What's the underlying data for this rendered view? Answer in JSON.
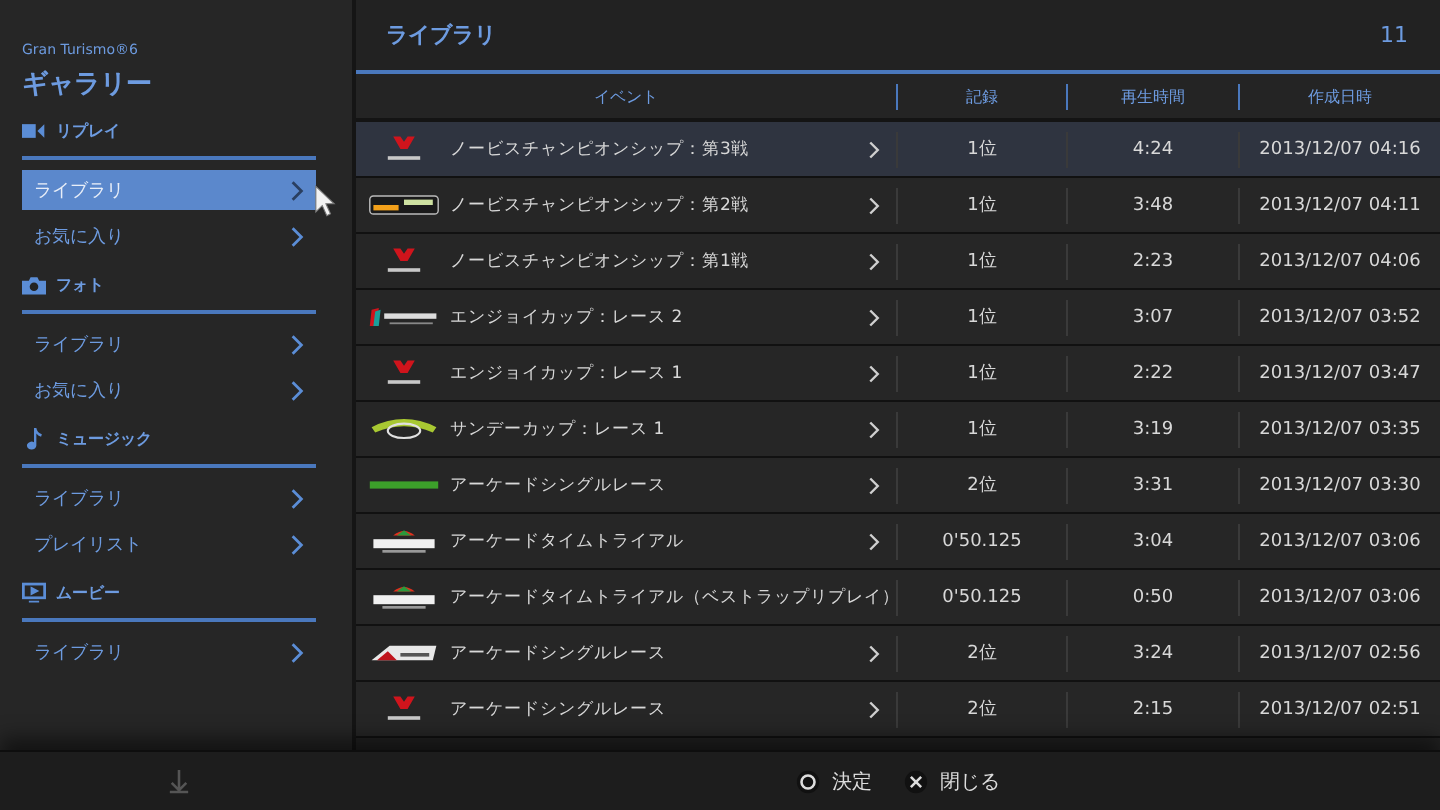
{
  "app": {
    "subtitle": "Gran Turismo®6",
    "title": "ギャラリー"
  },
  "sidebar": {
    "sections": [
      {
        "kind": "video",
        "label": "リプレイ",
        "items": [
          {
            "label": "ライブラリ",
            "selected": true
          },
          {
            "label": "お気に入り",
            "selected": false
          }
        ]
      },
      {
        "kind": "camera",
        "label": "フォト",
        "items": [
          {
            "label": "ライブラリ",
            "selected": false
          },
          {
            "label": "お気に入り",
            "selected": false
          }
        ]
      },
      {
        "kind": "music",
        "label": "ミュージック",
        "items": [
          {
            "label": "ライブラリ",
            "selected": false
          },
          {
            "label": "プレイリスト",
            "selected": false
          }
        ]
      },
      {
        "kind": "screen",
        "label": "ムービー",
        "items": [
          {
            "label": "ライブラリ",
            "selected": false
          }
        ]
      }
    ]
  },
  "panel": {
    "title": "ライブラリ",
    "count": "11"
  },
  "table": {
    "columns": [
      "イベント",
      "記録",
      "再生時間",
      "作成日時"
    ],
    "rows": [
      {
        "kind": "flag",
        "event": "ノービスチャンピオンシップ：第3戦",
        "record": "1位",
        "time": "4:24",
        "date": "2013/12/07 04:16",
        "selected": true
      },
      {
        "kind": "stripe",
        "event": "ノービスチャンピオンシップ：第2戦",
        "record": "1位",
        "time": "3:48",
        "date": "2013/12/07 04:11",
        "selected": false
      },
      {
        "kind": "flag",
        "event": "ノービスチャンピオンシップ：第1戦",
        "record": "1位",
        "time": "2:23",
        "date": "2013/12/07 04:06",
        "selected": false
      },
      {
        "kind": "wing",
        "event": "エンジョイカップ：レース 2",
        "record": "1位",
        "time": "3:07",
        "date": "2013/12/07 03:52",
        "selected": false
      },
      {
        "kind": "flag",
        "event": "エンジョイカップ：レース 1",
        "record": "1位",
        "time": "2:22",
        "date": "2013/12/07 03:47",
        "selected": false
      },
      {
        "kind": "swoosh",
        "event": "サンデーカップ：レース 1",
        "record": "1位",
        "time": "3:19",
        "date": "2013/12/07 03:35",
        "selected": false
      },
      {
        "kind": "bar",
        "event": "アーケードシングルレース",
        "record": "2位",
        "time": "3:31",
        "date": "2013/12/07 03:30",
        "selected": false
      },
      {
        "kind": "banner",
        "event": "アーケードタイムトライアル",
        "record": "0'50.125",
        "time": "3:04",
        "date": "2013/12/07 03:06",
        "selected": false
      },
      {
        "kind": "banner",
        "event": "アーケードタイムトライアル（ベストラップリプレイ）",
        "record": "0'50.125",
        "time": "0:50",
        "date": "2013/12/07 03:06",
        "selected": false
      },
      {
        "kind": "peak",
        "event": "アーケードシングルレース",
        "record": "2位",
        "time": "3:24",
        "date": "2013/12/07 02:56",
        "selected": false
      },
      {
        "kind": "flag",
        "event": "アーケードシングルレース",
        "record": "2位",
        "time": "2:15",
        "date": "2013/12/07 02:51",
        "selected": false
      }
    ]
  },
  "footer": {
    "actions": [
      {
        "kind": "circle",
        "label": "決定"
      },
      {
        "kind": "cross",
        "label": "閉じる"
      }
    ]
  }
}
